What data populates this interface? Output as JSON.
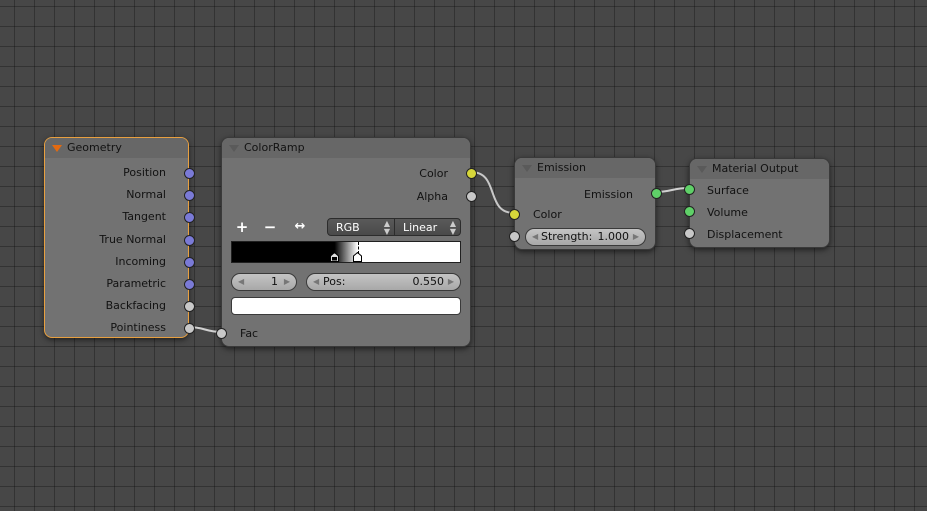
{
  "editor": "Node Editor",
  "nodes": {
    "geometry": {
      "title": "Geometry",
      "outputs": [
        {
          "label": "Position",
          "type": "vector"
        },
        {
          "label": "Normal",
          "type": "vector"
        },
        {
          "label": "Tangent",
          "type": "vector"
        },
        {
          "label": "True Normal",
          "type": "vector"
        },
        {
          "label": "Incoming",
          "type": "vector"
        },
        {
          "label": "Parametric",
          "type": "vector"
        },
        {
          "label": "Backfacing",
          "type": "float"
        },
        {
          "label": "Pointiness",
          "type": "float"
        }
      ]
    },
    "colorramp": {
      "title": "ColorRamp",
      "outputs": [
        {
          "label": "Color",
          "type": "color"
        },
        {
          "label": "Alpha",
          "type": "float"
        }
      ],
      "tools": {
        "add": "+",
        "remove": "−",
        "flip": "↔"
      },
      "color_mode": "RGB",
      "interpolation": "Linear",
      "stops": [
        {
          "position": 0.45,
          "color": "#000000"
        },
        {
          "position": 0.55,
          "color": "#ffffff",
          "active": true
        }
      ],
      "active_stop_index": "1",
      "pos_label": "Pos:",
      "pos_value": "0.550",
      "active_color": "#ffffff",
      "inputs": [
        {
          "label": "Fac",
          "type": "float"
        }
      ]
    },
    "emission": {
      "title": "Emission",
      "outputs": [
        {
          "label": "Emission",
          "type": "shader"
        }
      ],
      "inputs": [
        {
          "label": "Color",
          "type": "color"
        },
        {
          "label": "Strength:",
          "value": "1.000",
          "type": "float"
        }
      ]
    },
    "material_output": {
      "title": "Material Output",
      "inputs": [
        {
          "label": "Surface",
          "type": "shader"
        },
        {
          "label": "Volume",
          "type": "shader"
        },
        {
          "label": "Displacement",
          "type": "float"
        }
      ]
    }
  },
  "links": [
    {
      "from": "Geometry.Pointiness",
      "to": "ColorRamp.Fac"
    },
    {
      "from": "ColorRamp.Color",
      "to": "Emission.Color"
    },
    {
      "from": "Emission.Emission",
      "to": "Material Output.Surface"
    }
  ],
  "colors": {
    "active_border": "#e8a040",
    "socket_vector": "#7a7ad6",
    "socket_float": "#c8c8c8",
    "socket_color": "#d6d63a",
    "socket_shader": "#5fd068"
  }
}
